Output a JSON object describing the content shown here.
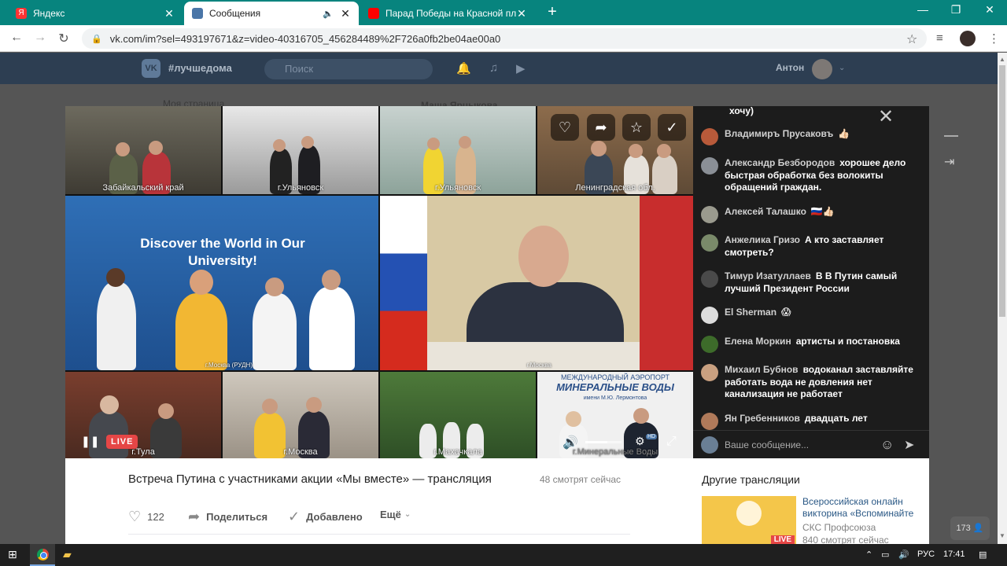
{
  "browser": {
    "tabs": [
      {
        "label": "Яндекс",
        "active": false
      },
      {
        "label": "Сообщения",
        "active": true
      },
      {
        "label": "Парад Победы на Красной пло",
        "active": false
      }
    ],
    "url": "vk.com/im?sel=493197671&z=video-40316705_456284489%2F726a0fb2be04ae00a0"
  },
  "vk_header": {
    "hashtag": "#лучшедома",
    "search_placeholder": "Поиск",
    "user_name": "Антон",
    "logo": "VK"
  },
  "background_hints": {
    "my_page": "Моя страница",
    "chat_name": "Маша Ярцыкова"
  },
  "video": {
    "tiles": [
      "Забайкальский край",
      "г.Ульяновск",
      "г.Ульяновск",
      "Ленинградская обл.",
      "г.Москва (РУДН)",
      "г.Москва",
      "г.Тула",
      "г.Москва",
      "г.Махачкала",
      "г.Минеральные Воды"
    ],
    "banner_text": "Discover the World in Our University!",
    "airport_line1": "МЕЖДУНАРОДНЫЙ АЭРОПОРТ",
    "airport_line2": "МИНЕРАЛЬНЫЕ ВОДЫ",
    "airport_line3": "имени М.Ю. Лермонтова",
    "live_badge": "LIVE",
    "hd_badge": "HD",
    "volume": 0.6
  },
  "chat": {
    "messages": [
      {
        "name": "",
        "body": "хочу)"
      },
      {
        "name": "Владимиръ Прусаковъ",
        "body": "👍🏻"
      },
      {
        "name": "Александр Безбородов",
        "body": "хорошее дело быстрая обработка без волокиты обращений граждан."
      },
      {
        "name": "Алексей Талашко",
        "body": "🇷🇺👍🏻"
      },
      {
        "name": "Анжелика Гризо",
        "body": "А кто заставляет смотреть?"
      },
      {
        "name": "Тимур Изатуллаев",
        "body": "В В Путин самый лучший Президент России"
      },
      {
        "name": "El Sherman",
        "body": "😱"
      },
      {
        "name": "Елена Моркин",
        "body": "артисты и постановка"
      },
      {
        "name": "Михаил Бубнов",
        "body": "водоканал заставляйте работать вода не довления нет канализация не работает"
      },
      {
        "name": "Ян Гребенников",
        "body": "двадцать лет"
      }
    ],
    "input_placeholder": "Ваше сообщение..."
  },
  "info": {
    "title": "Встреча Путина с участниками акции «Мы вместе» — трансляция",
    "viewers": "48 смотрят сейчас",
    "likes": "122",
    "share": "Поделиться",
    "added": "Добавлено",
    "more": "Ещё"
  },
  "other": {
    "heading": "Другие трансляции",
    "title": "Всероссийская онлайн викторина «Вспоминайте",
    "author": "СКС Профсоюза",
    "viewers": "840 смотрят сейчас",
    "live": "LIVE"
  },
  "counter": "173",
  "taskbar": {
    "lang": "РУС",
    "time": "17:41"
  },
  "colors": {
    "tabbar": "#07847e",
    "vk_header": "#2d3e52",
    "live": "#e64646",
    "link": "#2a5885"
  }
}
